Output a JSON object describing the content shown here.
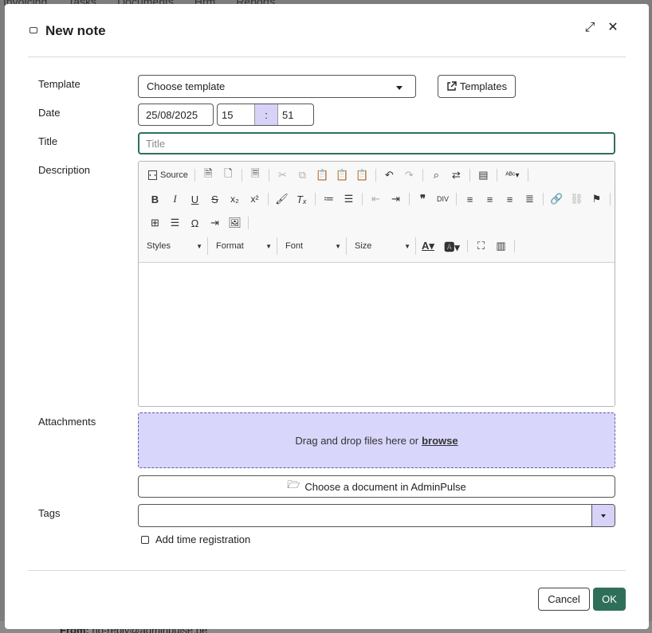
{
  "background": {
    "nav": [
      "Invoicing",
      "Tasks",
      "Documents",
      "Hrm",
      "Reports"
    ],
    "from_label": "From:",
    "from_value": "no-reply@adminpulse.be"
  },
  "dialog": {
    "title": "New note",
    "expand_icon": "⤢",
    "close_icon": "✕"
  },
  "labels": {
    "template": "Template",
    "date": "Date",
    "title": "Title",
    "description": "Description",
    "attachments": "Attachments",
    "tags": "Tags"
  },
  "template": {
    "selected": "Choose template",
    "templates_button": "Templates"
  },
  "date": {
    "value": "25/08/2025",
    "hour": "15",
    "separator": ":",
    "minute": "51"
  },
  "title_field": {
    "placeholder": "Title",
    "value": ""
  },
  "editor": {
    "source_label": "Source",
    "styles_label": "Styles",
    "format_label": "Format",
    "font_label": "Font",
    "size_label": "Size"
  },
  "attachments": {
    "drop_text": "Drag and drop files here or",
    "browse": "browse",
    "choose_document": "Choose a document in AdminPulse"
  },
  "time_registration_label": "Add time registration",
  "footer": {
    "cancel": "Cancel",
    "ok": "OK"
  },
  "colors": {
    "primary": "#2f6f5a",
    "lavender": "#d9d6fb"
  }
}
